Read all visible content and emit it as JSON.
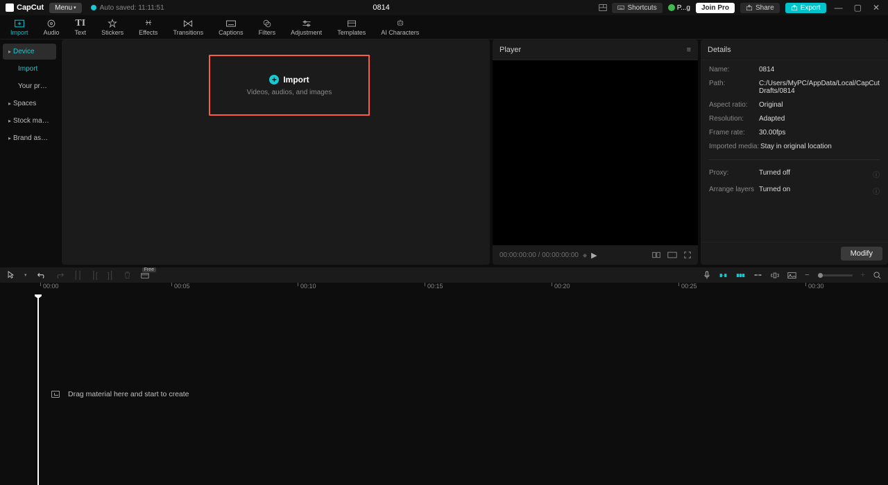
{
  "app": {
    "name": "CapCut",
    "menuLabel": "Menu"
  },
  "autosave": {
    "label": "Auto saved: 11:11:51"
  },
  "project": {
    "title": "0814"
  },
  "titlebar": {
    "shortcuts": "Shortcuts",
    "pg": "P...g",
    "joinPro": "Join Pro",
    "share": "Share",
    "export": "Export"
  },
  "tooltabs": [
    {
      "id": "import",
      "label": "Import",
      "active": true
    },
    {
      "id": "audio",
      "label": "Audio"
    },
    {
      "id": "text",
      "label": "Text"
    },
    {
      "id": "stickers",
      "label": "Stickers"
    },
    {
      "id": "effects",
      "label": "Effects"
    },
    {
      "id": "transitions",
      "label": "Transitions"
    },
    {
      "id": "captions",
      "label": "Captions"
    },
    {
      "id": "filters",
      "label": "Filters"
    },
    {
      "id": "adjustment",
      "label": "Adjustment"
    },
    {
      "id": "templates",
      "label": "Templates"
    },
    {
      "id": "ai",
      "label": "AI Characters"
    }
  ],
  "sidebar": {
    "items": [
      {
        "label": "Device",
        "cls": "exp active"
      },
      {
        "label": "Import",
        "cls": "sub activeblue"
      },
      {
        "label": "Your presets",
        "cls": "sub"
      },
      {
        "label": "Spaces",
        "cls": "exp"
      },
      {
        "label": "Stock mate...",
        "cls": "exp"
      },
      {
        "label": "Brand assets",
        "cls": "exp"
      }
    ]
  },
  "importCard": {
    "title": "Import",
    "sub": "Videos, audios, and images"
  },
  "player": {
    "title": "Player",
    "timecode": "00:00:00:00 / 00:00:00:00"
  },
  "details": {
    "title": "Details",
    "rows": {
      "nameL": "Name:",
      "nameV": "0814",
      "pathL": "Path:",
      "pathV": "C:/Users/MyPC/AppData/Local/CapCut Drafts/0814",
      "aspectL": "Aspect ratio:",
      "aspectV": "Original",
      "resL": "Resolution:",
      "resV": "Adapted",
      "frameL": "Frame rate:",
      "frameV": "30.00fps",
      "impL": "Imported media:",
      "impV": "Stay in original location",
      "proxyL": "Proxy:",
      "proxyV": "Turned off",
      "arrL": "Arrange layers",
      "arrV": "Turned on"
    },
    "modify": "Modify"
  },
  "timeline": {
    "freeTag": "Free",
    "ticks": [
      "00:00",
      "00:05",
      "00:10",
      "00:15",
      "00:20",
      "00:25",
      "00:30"
    ],
    "dropHint": "Drag material here and start to create"
  }
}
